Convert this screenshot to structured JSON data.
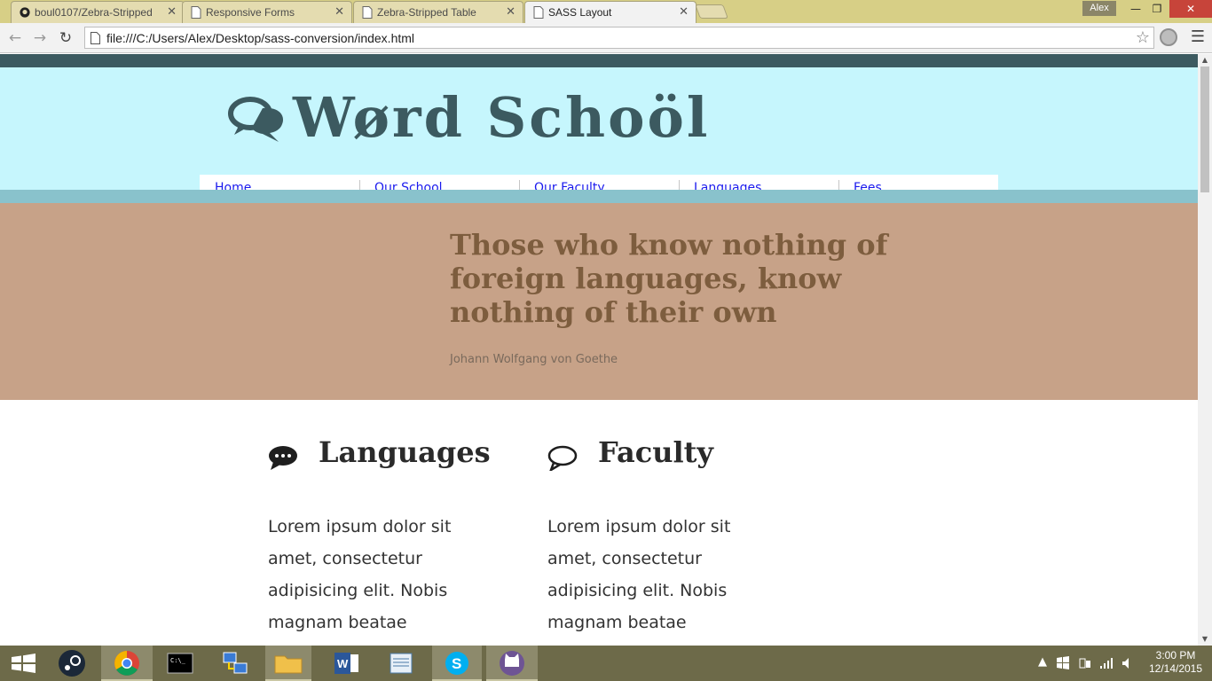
{
  "browser": {
    "tabs": [
      {
        "title": "boul0107/Zebra-Stripped",
        "icon": "github-icon",
        "active": false
      },
      {
        "title": "Responsive Forms",
        "icon": "page-icon",
        "active": false
      },
      {
        "title": "Zebra-Stripped Table",
        "icon": "page-icon",
        "active": false
      },
      {
        "title": "SASS Layout",
        "icon": "page-icon",
        "active": true
      }
    ],
    "close_glyph": "✕",
    "user": "Alex",
    "url": "file:///C:/Users/Alex/Desktop/sass-conversion/index.html"
  },
  "page": {
    "logo": "Wørd Schoöl",
    "nav": [
      "Home",
      "Our School",
      "Our Faculty",
      "Languages",
      "Fees"
    ],
    "quote": "Those who know nothing of foreign languages, know nothing of their own",
    "quote_author": "Johann Wolfgang von Goethe",
    "columns": [
      {
        "title": "Languages",
        "icon": "speech-bubble-filled-icon",
        "body": "Lorem ipsum dolor sit amet, consectetur adipisicing elit. Nobis magnam beatae"
      },
      {
        "title": "Faculty",
        "icon": "speech-bubble-outline-icon",
        "body": "Lorem ipsum dolor sit amet, consectetur adipisicing elit. Nobis magnam beatae"
      }
    ],
    "colors": {
      "header_bg": "#c6f6fd",
      "topstrip": "#3c5a60",
      "nav_bottom": "#89c2cc",
      "hero_bg": "#c7a288",
      "quote": "#7d5d3e"
    }
  },
  "taskbar": {
    "apps": [
      "windows-start-icon",
      "steam-icon",
      "chrome-icon",
      "cmd-icon",
      "network-icon",
      "file-explorer-icon",
      "word-icon",
      "notepad-icon",
      "skype-icon",
      "github-desktop-icon"
    ],
    "time": "3:00 PM",
    "date": "12/14/2015"
  }
}
